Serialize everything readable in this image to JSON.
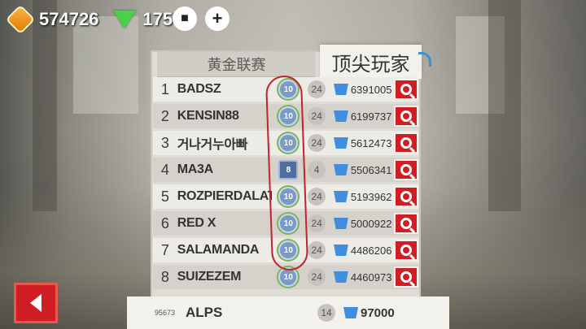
{
  "hud": {
    "coins": "574726",
    "gems": "175"
  },
  "tabs": {
    "gold_league": "黄金联赛",
    "top_players": "顶尖玩家"
  },
  "leaderboard": [
    {
      "rank": "1",
      "name": "BADSZ",
      "badge": "10",
      "level": "24",
      "score": "6391005"
    },
    {
      "rank": "2",
      "name": "KENSIN88",
      "badge": "10",
      "level": "24",
      "score": "6199737"
    },
    {
      "rank": "3",
      "name": "거나거누아빠",
      "badge": "10",
      "level": "24",
      "score": "5612473"
    },
    {
      "rank": "4",
      "name": "MA3A",
      "badge": "8",
      "level": "4",
      "score": "5506341"
    },
    {
      "rank": "5",
      "name": "ROZPIERDALATOR",
      "badge": "10",
      "level": "24",
      "score": "5193962"
    },
    {
      "rank": "6",
      "name": "RED X",
      "badge": "10",
      "level": "24",
      "score": "5000922"
    },
    {
      "rank": "7",
      "name": "SALAMANDA",
      "badge": "10",
      "level": "24",
      "score": "4486206"
    },
    {
      "rank": "8",
      "name": "SUIZEZEM",
      "badge": "10",
      "level": "24",
      "score": "4460973"
    }
  ],
  "self": {
    "rank": "95673",
    "name": "ALPS",
    "level": "14",
    "score": "97000"
  },
  "colors": {
    "accent_red": "#d11e24",
    "trophy_blue": "#3f8ee0"
  }
}
